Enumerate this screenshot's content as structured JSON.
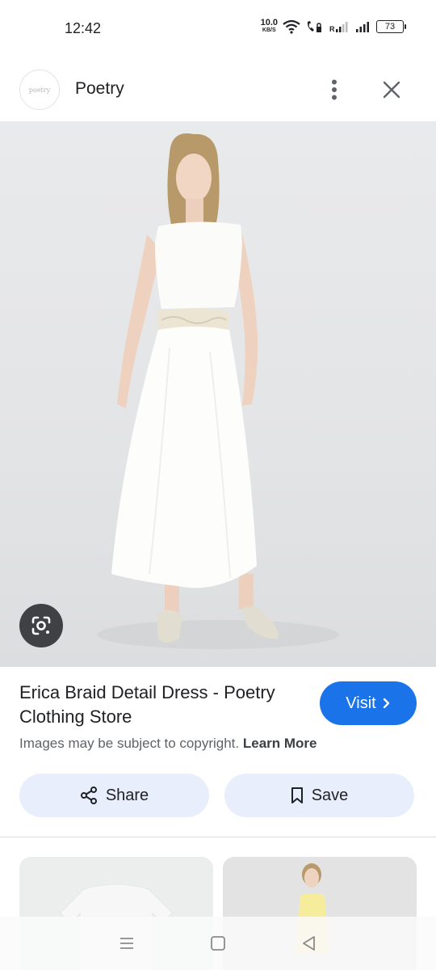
{
  "status_bar": {
    "time": "12:42",
    "net_speed_value": "10.0",
    "net_speed_unit": "KB/S",
    "battery": "73"
  },
  "header": {
    "logo_text": "poetry",
    "site_name": "Poetry",
    "more_icon": "more-vert-icon",
    "close_icon": "close-icon"
  },
  "product": {
    "title": "Erica Braid Detail Dress - Poetry Clothing Store",
    "visit_label": "Visit",
    "copyright_text": "Images may be subject to copyright.",
    "learn_more": "Learn More",
    "share_label": "Share",
    "save_label": "Save"
  },
  "colors": {
    "accent": "#1a73e8",
    "pill_bg": "#e8eefc"
  }
}
